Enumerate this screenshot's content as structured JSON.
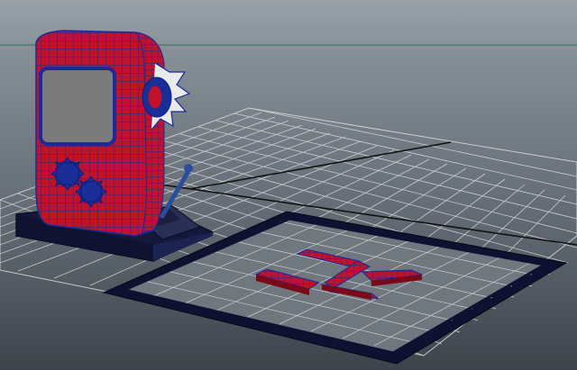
{
  "viewport": {
    "view": "perspective",
    "scene_objects": [
      "slot-machine",
      "control-lever",
      "helipad",
      "helipad-letter"
    ],
    "helipad_letter": "H",
    "colors": {
      "background_top": "#9aa2a9",
      "background_bottom": "#3d444b",
      "grid_line": "#cfd3d6",
      "axis_line": "#111111",
      "mesh_red": "#c0122a",
      "wireframe_blue": "#1a2a9a",
      "screen_gray": "#7b7b7b",
      "base_navy": "#14183a"
    }
  }
}
